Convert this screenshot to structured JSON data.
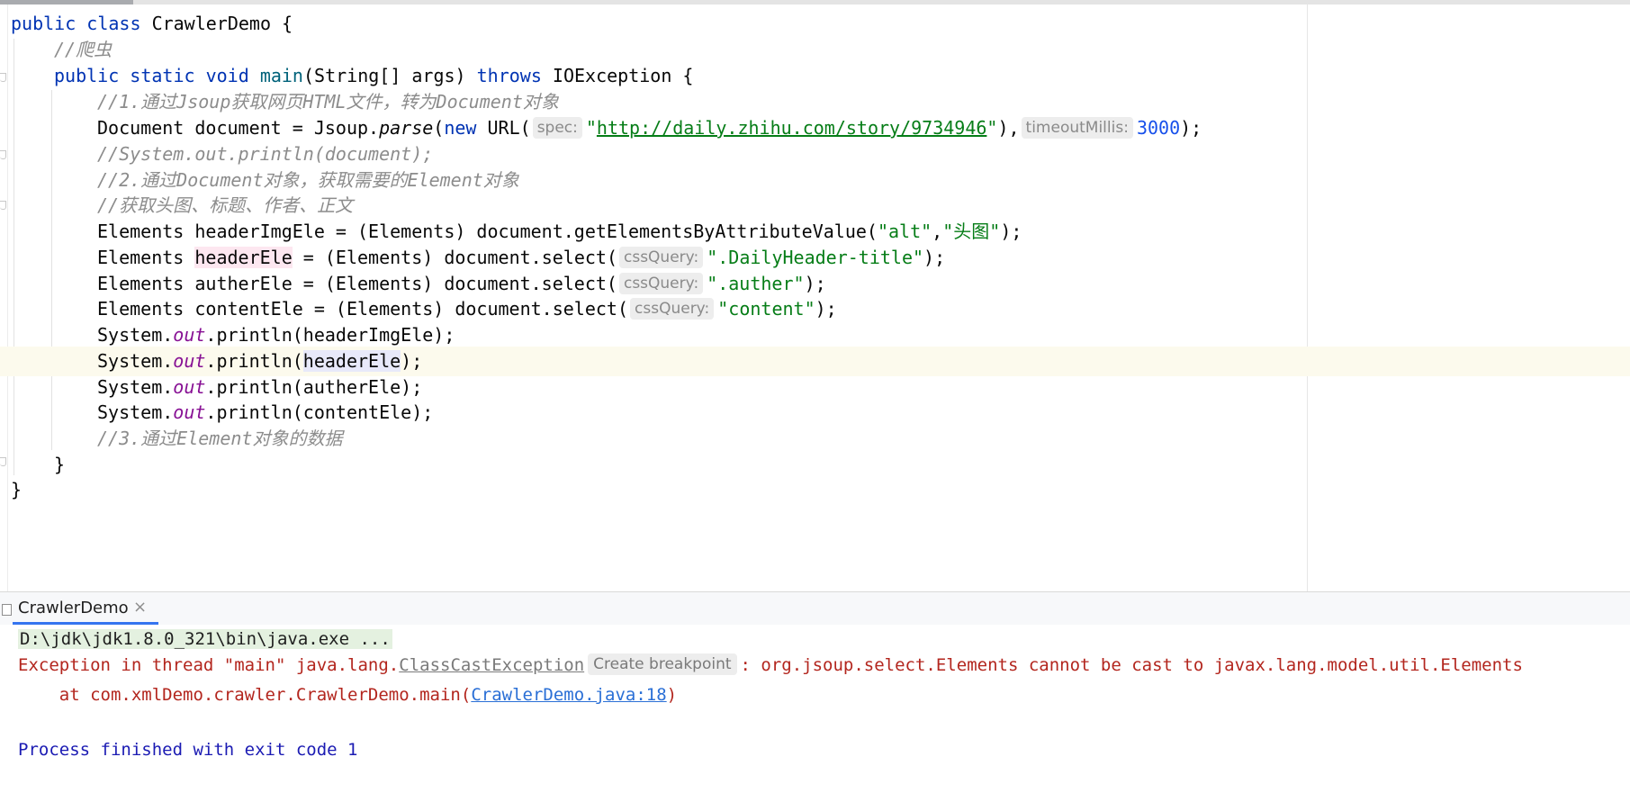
{
  "editor": {
    "lines": [
      {
        "tokens": [
          [
            "kw",
            "public"
          ],
          [
            "",
            "⎵"
          ],
          [
            "kw",
            "class"
          ],
          [
            "",
            ""
          ],
          [
            "",
            "CrawlerDemo {"
          ]
        ]
      },
      {
        "tokens": [
          [
            "cm",
            "//爬虫"
          ]
        ]
      },
      {
        "tokens": [
          [
            "kw",
            "public"
          ],
          [
            "kw",
            "static"
          ],
          [
            "kw",
            "void"
          ],
          [
            "fn",
            "main"
          ],
          [
            "",
            "(String[] args)"
          ],
          [
            "kw",
            "throws"
          ],
          [
            "",
            "IOException {"
          ]
        ]
      }
    ],
    "code": {
      "l1_kw1": "public",
      "l1_kw2": "class",
      "l1_rest": "CrawlerDemo {",
      "l2_comment": "//爬虫",
      "l3_kw1": "public",
      "l3_kw2": "static",
      "l3_kw3": "void",
      "l3_fn": "main",
      "l3_args": "(String[] args) ",
      "l3_kw4": "throws",
      "l3_rest": " IOException {",
      "l4_comment": "//1.通过Jsoup获取网页HTML文件，转为Document对象",
      "l5_a": "Document document = Jsoup.",
      "l5_parse": "parse",
      "l5_b": "(",
      "l5_new": "new",
      "l5_c": " URL(",
      "l5_hint1": "spec:",
      "l5_q1": "\"",
      "l5_url": "http://daily.zhihu.com/story/9734946",
      "l5_q2": "\"",
      "l5_d": "),",
      "l5_hint2": "timeoutMillis:",
      "l5_num": "3000",
      "l5_e": ");",
      "l6_comment": "//System.out.println(document);",
      "l7_comment": "//2.通过Document对象，获取需要的Element对象",
      "l8_comment": "//获取头图、标题、作者、正文",
      "l9_a": "Elements headerImgEle = (Elements) document.getElementsByAttributeValue(",
      "l9_s1": "\"alt\"",
      "l9_b": ",",
      "l9_s2": "\"头图\"",
      "l9_c": ");",
      "l10_a": "Elements ",
      "l10_var": "headerEle",
      "l10_b": " = (Elements) document.select(",
      "l10_hint": "cssQuery:",
      "l10_s": "\".DailyHeader-title\"",
      "l10_c": ");",
      "l11_a": "Elements autherEle = (Elements) document.select(",
      "l11_hint": "cssQuery:",
      "l11_s": "\".auther\"",
      "l11_c": ");",
      "l12_a": "Elements contentEle = (Elements) document.select(",
      "l12_hint": "cssQuery:",
      "l12_s": "\"content\"",
      "l12_c": ");",
      "sys": "System.",
      "out": "out",
      "println": ".println(",
      "l13_arg": "headerImgEle",
      "l14_arg": "headerEle",
      "l15_arg": "autherEle",
      "l16_arg": "contentEle",
      "close_paren": ");",
      "l17_comment": "//3.通过Element对象的数据",
      "l18": "}",
      "l19": "}"
    }
  },
  "run_panel": {
    "tab_label": "CrawlerDemo",
    "tab_close": "×"
  },
  "console": {
    "command": "D:\\jdk\\jdk1.8.0_321\\bin\\java.exe ...",
    "exception_prefix": "Exception in thread \"main\" java.lang.",
    "exception_class": "ClassCastException",
    "breakpoint_hint": "Create breakpoint",
    "exception_suffix": ": org.jsoup.select.Elements cannot be cast to javax.lang.model.util.Elements",
    "trace_prefix": "    at com.xmlDemo.crawler.CrawlerDemo.main(",
    "trace_link": "CrawlerDemo.java:18",
    "trace_suffix": ")",
    "exit_message": "Process finished with exit code 1"
  }
}
